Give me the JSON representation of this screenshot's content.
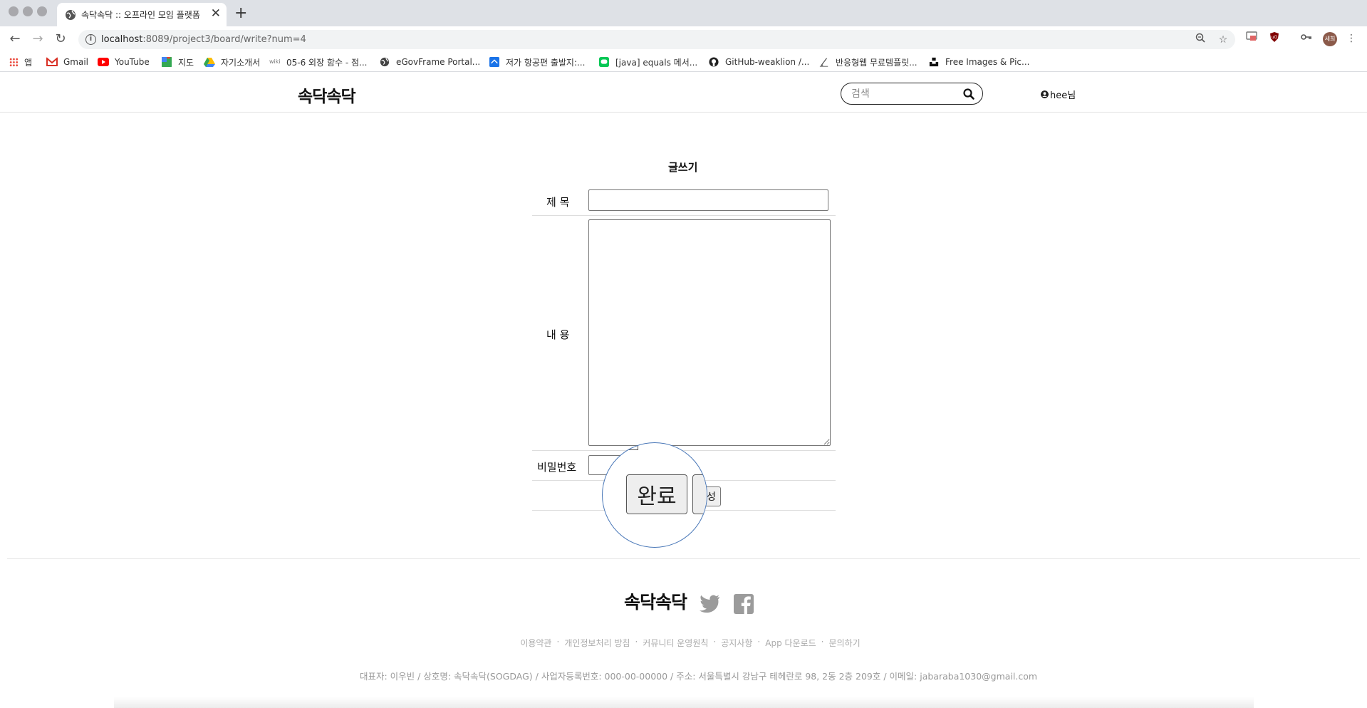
{
  "browser": {
    "tab_title": "속닥속닥 :: 오프라인 모임 플랫폼",
    "url_host": "localhost",
    "url_path": ":8089/project3/board/write?num=4",
    "profile_initials": "세희",
    "bookmarks": [
      {
        "label": "앱",
        "icon": "apps-grid-icon",
        "color": "#e94235"
      },
      {
        "label": "Gmail",
        "icon": "gmail-icon",
        "color": "#d93025"
      },
      {
        "label": "YouTube",
        "icon": "youtube-icon",
        "color": "#ff0000"
      },
      {
        "label": "지도",
        "icon": "maps-icon",
        "color": "#34a853"
      },
      {
        "label": "자기소개서",
        "icon": "drive-icon",
        "color": "#fbbc04"
      },
      {
        "label": "05-6 외장 함수 - 점...",
        "icon": "wikidocs-icon",
        "color": "#777777"
      },
      {
        "label": "eGovFrame Portal...",
        "icon": "globe-icon",
        "color": "#444444"
      },
      {
        "label": "저가 항공편 출발지:...",
        "icon": "flight-icon",
        "color": "#1a73e8"
      },
      {
        "label": "[java] equals 메서...",
        "icon": "line-icon",
        "color": "#06c755"
      },
      {
        "label": "GitHub-weaklion /...",
        "icon": "github-icon",
        "color": "#222222"
      },
      {
        "label": "반응형웹 무료템플릿...",
        "icon": "pen-icon",
        "color": "#555555"
      },
      {
        "label": "Free Images & Pic...",
        "icon": "unsplash-icon",
        "color": "#111111"
      }
    ]
  },
  "site": {
    "logo": "속닥속닥",
    "search_placeholder": "검색",
    "user_label": "hee님"
  },
  "form": {
    "heading": "글쓰기",
    "title_label": "제 목",
    "content_label": "내 용",
    "password_label": "비밀번호",
    "submit_label": "완료",
    "second_button_label": "성",
    "title_value": "",
    "content_value": "",
    "password_value": ""
  },
  "footer": {
    "logo": "속닥속닥",
    "links": [
      "이용약관",
      "개인정보처리 방침",
      "커뮤니티 운영원칙",
      "공지사항",
      "App 다운로드",
      "문의하기"
    ],
    "info": "대표자: 이우빈 / 상호명: 속닥속닥(SOGDAG) / 사업자등록번호: 000-00-00000 / 주소: 서울특별시 강남구 테헤란로 98, 2동 2층 209호 / 이메일: jabaraba1030@gmail.com"
  }
}
